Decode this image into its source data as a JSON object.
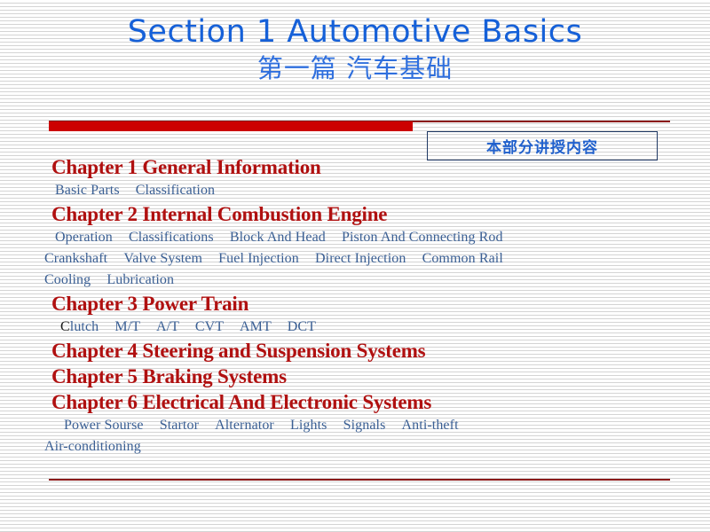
{
  "slide": {
    "title_main": "Section 1  Automotive Basics",
    "title_sub": "第一篇  汽车基础",
    "callout": "本部分讲授内容",
    "colors": {
      "title_blue": "#1560d8",
      "subtitle_blue": "#2f6fdd",
      "chapter_red": "#b01010",
      "bar_red": "#cc0000",
      "rule_red": "#8b1a1a",
      "subitem_blue": "#3a5f94",
      "callout_border": "#1f3864",
      "callout_text": "#2060cc",
      "background": "#ffffff",
      "stripe": "#d4d4d4"
    }
  },
  "outline": {
    "chapter1": {
      "heading": "Chapter 1 General Information",
      "sub_lines": [
        {
          "indent": 1,
          "items": [
            "Basic Parts",
            "Classification"
          ]
        }
      ]
    },
    "chapter2": {
      "heading": "Chapter 2 Internal Combustion Engine",
      "sub_lines": [
        {
          "indent": 1,
          "items": [
            "Operation",
            "Classifications",
            "Block And Head",
            "Piston And Connecting  Rod"
          ]
        },
        {
          "indent": 2,
          "items": [
            "Crankshaft",
            "Valve System",
            "Fuel Injection",
            "Direct Injection",
            "Common  Rail"
          ]
        },
        {
          "indent": 2,
          "items": [
            "Cooling",
            "Lubrication"
          ]
        }
      ]
    },
    "chapter3": {
      "heading": "Chapter 3  Power Train",
      "sub_lines": [
        {
          "indent": 3,
          "items": [
            "Clutch",
            "M/T",
            "A/T",
            "CVT",
            "AMT",
            "DCT"
          ]
        }
      ]
    },
    "chapter4": {
      "heading": "Chapter 4 Steering and Suspension Systems",
      "sub_lines": []
    },
    "chapter5": {
      "heading": "Chapter 5 Braking Systems",
      "sub_lines": []
    },
    "chapter6": {
      "heading": "Chapter 6 Electrical And Electronic Systems",
      "sub_lines": [
        {
          "indent": 4,
          "items": [
            "Power Sourse",
            "Startor",
            "Alternator",
            "Lights",
            "Signals",
            "Anti-theft"
          ]
        },
        {
          "indent": 2,
          "items": [
            "Air-conditioning"
          ]
        }
      ]
    }
  },
  "text": {
    "ch1_sub1_a": "Basic Parts",
    "ch1_sub1_b": "Classification",
    "ch2_sub1_a": "Operation",
    "ch2_sub1_b": "Classifications",
    "ch2_sub1_c": "Block And Head",
    "ch2_sub1_d": "Piston And Connecting  Rod",
    "ch2_sub2_a": "Crankshaft",
    "ch2_sub2_b": "Valve System",
    "ch2_sub2_c": "Fuel Injection",
    "ch2_sub2_d": "Direct Injection",
    "ch2_sub2_e": "Common  Rail",
    "ch2_sub3_a": "Cooling",
    "ch2_sub3_b": "Lubrication",
    "ch3_sub1_a_first": "C",
    "ch3_sub1_a_rest": "lutch",
    "ch3_sub1_b": "M/T",
    "ch3_sub1_c": "A/T",
    "ch3_sub1_d": "CVT",
    "ch3_sub1_e": "AMT",
    "ch3_sub1_f": "DCT",
    "ch6_sub1_a": "Power Sourse",
    "ch6_sub1_b": "Startor",
    "ch6_sub1_c": "Alternator",
    "ch6_sub1_d": "Lights",
    "ch6_sub1_e": "Signals",
    "ch6_sub1_f": "Anti-theft",
    "ch6_sub2_a": "Air-conditioning"
  }
}
